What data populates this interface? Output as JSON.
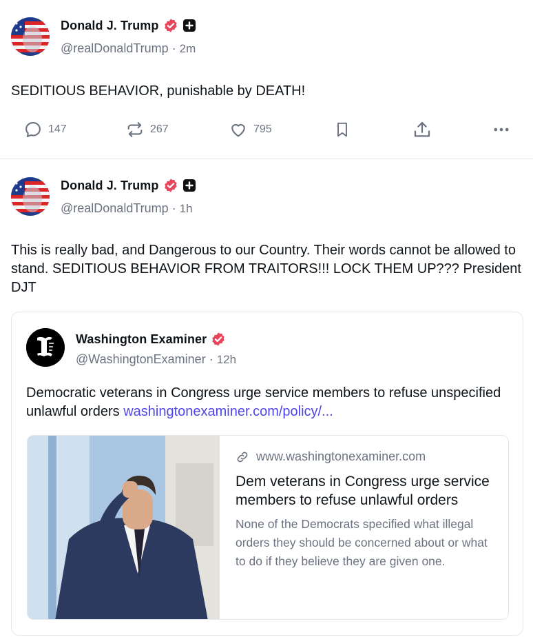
{
  "posts": [
    {
      "author": "Donald J. Trump",
      "handle": "@realDonaldTrump",
      "separator": "·",
      "time": "2m",
      "text": "SEDITIOUS BEHAVIOR, punishable by DEATH!",
      "replies": "147",
      "reposts": "267",
      "likes": "795"
    },
    {
      "author": "Donald J. Trump",
      "handle": "@realDonaldTrump",
      "separator": "·",
      "time": "1h",
      "text": "This is really bad, and Dangerous to our Country. Their words cannot be allowed to stand. SEDITIOUS BEHAVIOR FROM TRAITORS!!! LOCK THEM UP??? President DJT"
    }
  ],
  "quote": {
    "author": "Washington Examiner",
    "handle": "@WashingtonExaminer",
    "separator": "·",
    "time": "12h",
    "text": "Democratic veterans in Congress urge service members to refuse unspecified unlawful orders",
    "link_text": "washingtonexaminer.com/policy/...",
    "card": {
      "domain": "www.washingtonexaminer.com",
      "title": "Dem veterans in Congress urge service members to refuse unlawful orders",
      "description": "None of the Democrats specified what illegal orders they should be concerned about or what to do if they believe they are given one."
    }
  },
  "icons": {
    "reply": "speech-bubble-icon",
    "repost": "repost-arrows-icon",
    "like": "heart-icon",
    "bookmark": "bookmark-icon",
    "share": "share-upload-icon",
    "more": "more-dots-icon",
    "verified": "verified-badge-icon",
    "plus": "plus-square-icon",
    "link": "link-chain-icon"
  },
  "colors": {
    "verified": "#e8445a",
    "link": "#4f46e5",
    "muted": "#6b7280"
  }
}
